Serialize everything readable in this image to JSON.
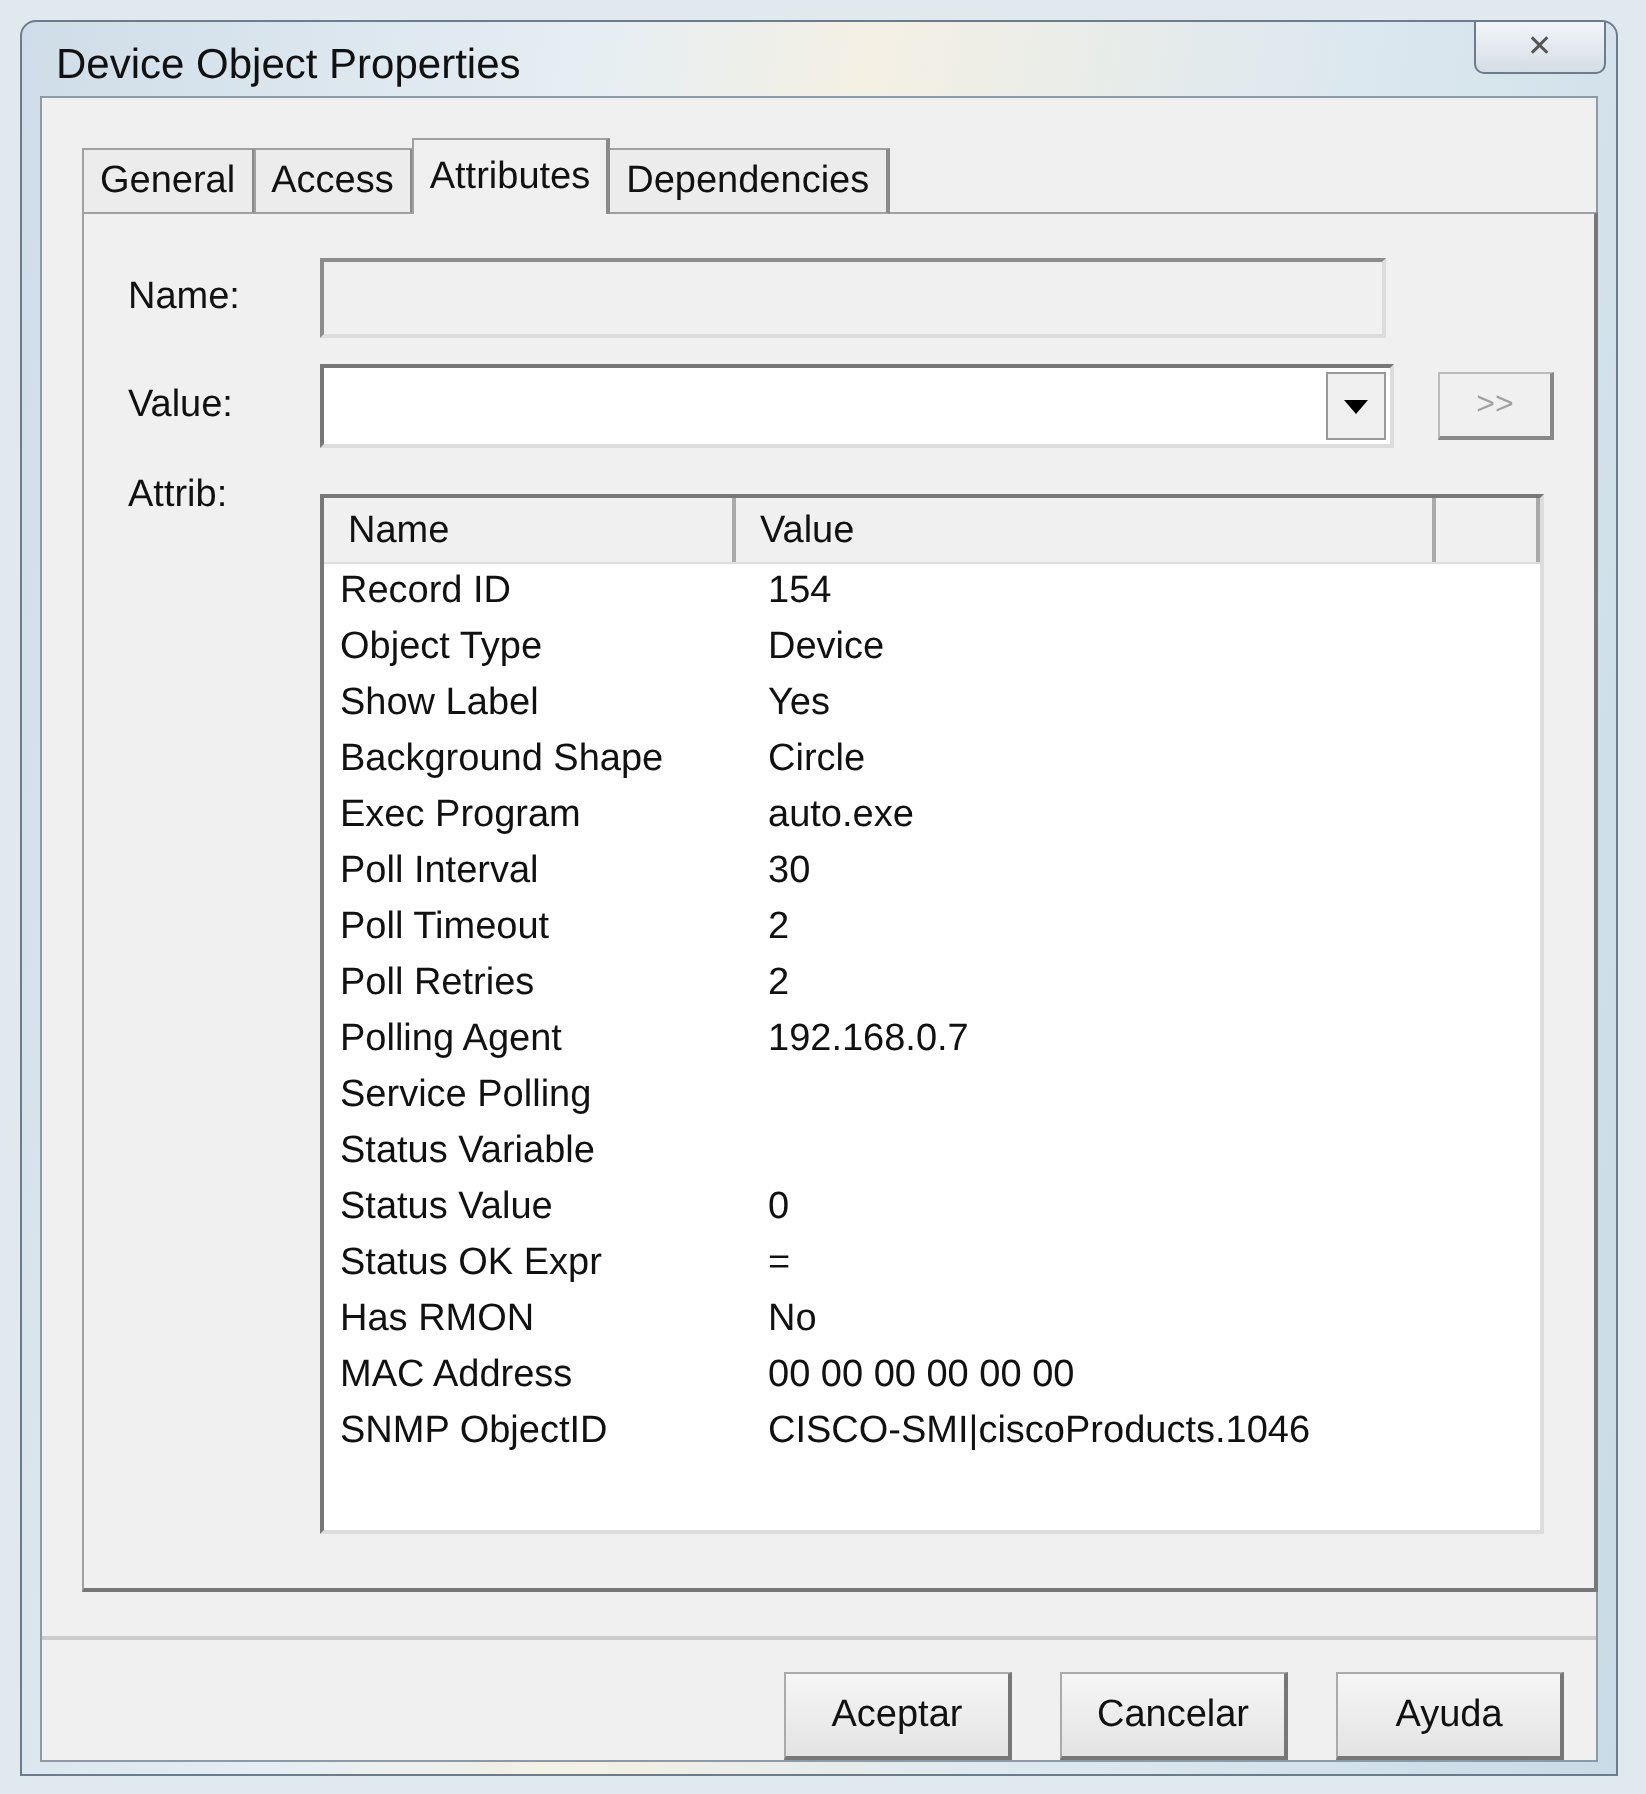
{
  "window": {
    "title": "Device Object Properties",
    "close": "✕"
  },
  "tabs": [
    {
      "label": "General",
      "selected": false
    },
    {
      "label": "Access",
      "selected": false
    },
    {
      "label": "Attributes",
      "selected": true
    },
    {
      "label": "Dependencies",
      "selected": false
    }
  ],
  "fields": {
    "name_label": "Name:",
    "name_disabled": true,
    "value_label": "Value:",
    "add_button": {
      "label": ">>",
      "disabled": true
    },
    "attrib_label": "Attrib:"
  },
  "table": {
    "columns": [
      "Name",
      "Value"
    ],
    "rows": [
      [
        "Record ID",
        "154"
      ],
      [
        "Object Type",
        "Device"
      ],
      [
        "Show Label",
        "Yes"
      ],
      [
        "Background Shape",
        "Circle"
      ],
      [
        "Exec Program",
        "auto.exe"
      ],
      [
        "Poll Interval",
        "30"
      ],
      [
        "Poll Timeout",
        "2"
      ],
      [
        "Poll Retries",
        "2"
      ],
      [
        "Polling Agent",
        "192.168.0.7"
      ],
      [
        "Service Polling",
        ""
      ],
      [
        "Status Variable",
        ""
      ],
      [
        "Status Value",
        "0"
      ],
      [
        "Status OK Expr",
        "="
      ],
      [
        "Has RMON",
        "No"
      ],
      [
        "MAC Address",
        "00 00 00 00 00 00"
      ],
      [
        "SNMP ObjectID",
        "CISCO-SMI|ciscoProducts.1046"
      ]
    ]
  },
  "buttons": [
    "Aceptar",
    "Cancelar",
    "Ayuda"
  ]
}
